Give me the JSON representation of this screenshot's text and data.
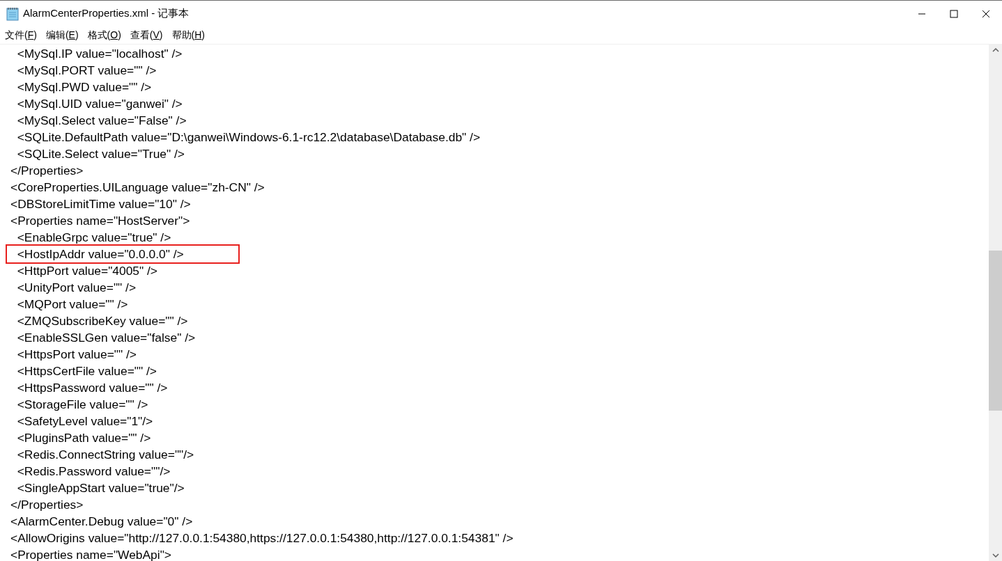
{
  "window": {
    "title": "AlarmCenterProperties.xml - 记事本"
  },
  "menu": [
    {
      "label": "文件(",
      "key": "F",
      "end": ")"
    },
    {
      "label": "编辑(",
      "key": "E",
      "end": ")"
    },
    {
      "label": "格式(",
      "key": "O",
      "end": ")"
    },
    {
      "label": "查看(",
      "key": "V",
      "end": ")"
    },
    {
      "label": "帮助(",
      "key": "H",
      "end": ")"
    }
  ],
  "editor": {
    "lines": [
      {
        "text": "  <MySql.IP value=\"localhost\" />",
        "highlighted": false
      },
      {
        "text": "  <MySql.PORT value=\"\" />",
        "highlighted": false
      },
      {
        "text": "  <MySql.PWD value=\"\" />",
        "highlighted": false
      },
      {
        "text": "  <MySql.UID value=\"ganwei\" />",
        "highlighted": false
      },
      {
        "text": "  <MySql.Select value=\"False\" />",
        "highlighted": false
      },
      {
        "text": "  <SQLite.DefaultPath value=\"D:\\ganwei\\Windows-6.1-rc12.2\\database\\Database.db\" />",
        "highlighted": false
      },
      {
        "text": "  <SQLite.Select value=\"True\" />",
        "highlighted": false
      },
      {
        "text": "</Properties>",
        "highlighted": false
      },
      {
        "text": "<CoreProperties.UILanguage value=\"zh-CN\" />",
        "highlighted": false
      },
      {
        "text": "<DBStoreLimitTime value=\"10\" />",
        "highlighted": false
      },
      {
        "text": "<Properties name=\"HostServer\">",
        "highlighted": false
      },
      {
        "text": "  <EnableGrpc value=\"true\" />",
        "highlighted": false
      },
      {
        "text": "  <HostIpAddr value=\"0.0.0.0\" />",
        "highlighted": true
      },
      {
        "text": "  <HttpPort value=\"4005\" />",
        "highlighted": false
      },
      {
        "text": "  <UnityPort value=\"\" />",
        "highlighted": false
      },
      {
        "text": "  <MQPort value=\"\" />",
        "highlighted": false
      },
      {
        "text": "  <ZMQSubscribeKey value=\"\" />",
        "highlighted": false
      },
      {
        "text": "  <EnableSSLGen value=\"false\" />",
        "highlighted": false
      },
      {
        "text": "  <HttpsPort value=\"\" />",
        "highlighted": false
      },
      {
        "text": "  <HttpsCertFile value=\"\" />",
        "highlighted": false
      },
      {
        "text": "  <HttpsPassword value=\"\" />",
        "highlighted": false
      },
      {
        "text": "  <StorageFile value=\"\" />",
        "highlighted": false
      },
      {
        "text": "  <SafetyLevel value=\"1\"/>",
        "highlighted": false
      },
      {
        "text": "  <PluginsPath value=\"\" />",
        "highlighted": false
      },
      {
        "text": "  <Redis.ConnectString value=\"\"/>",
        "highlighted": false
      },
      {
        "text": "  <Redis.Password value=\"\"/>",
        "highlighted": false
      },
      {
        "text": "  <SingleAppStart value=\"true\"/>",
        "highlighted": false
      },
      {
        "text": "</Properties>",
        "highlighted": false
      },
      {
        "text": "<AlarmCenter.Debug value=\"0\" />",
        "highlighted": false
      },
      {
        "text": "<AllowOrigins value=\"http://127.0.0.1:54380,https://127.0.0.1:54380,http://127.0.0.1:54381\" />",
        "highlighted": false
      },
      {
        "text": "<Properties name=\"WebApi\">",
        "highlighted": false
      }
    ]
  }
}
